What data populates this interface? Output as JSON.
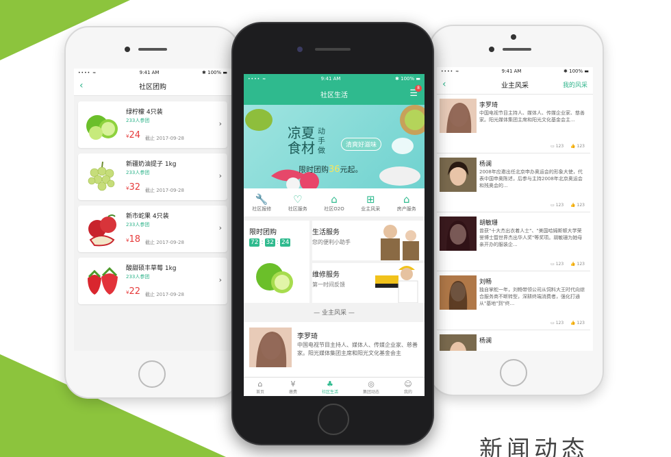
{
  "colors": {
    "accent": "#2fba8e",
    "brand_green": "#8cc43d",
    "price_red": "#e63a3a"
  },
  "news_title": "新闻动态",
  "left_phone": {
    "status": {
      "time": "9:41 AM",
      "battery": "100%"
    },
    "nav_title": "社区团购",
    "products": [
      {
        "name": "绿柠檬 4只装",
        "joined": "233人参团",
        "price": "24",
        "currency": "¥",
        "deadline": "截止 2017-09-28"
      },
      {
        "name": "新疆奶油提子 1kg",
        "joined": "233人参团",
        "price": "32",
        "currency": "¥",
        "deadline": "截止 2017-09-28"
      },
      {
        "name": "新市蛇果 4只装",
        "joined": "233人参团",
        "price": "18",
        "currency": "¥",
        "deadline": "截止 2017-09-28"
      },
      {
        "name": "酸甜硕丰草莓 1kg",
        "joined": "233人参团",
        "price": "22",
        "currency": "¥",
        "deadline": "截止 2017-09-28"
      }
    ]
  },
  "center_phone": {
    "status": {
      "time": "9:41 AM",
      "battery": "100%"
    },
    "nav_title": "社区生活",
    "message_badge": "8",
    "banner": {
      "title_a": "凉夏",
      "title_b": "食材",
      "title_side": "动手做",
      "pill": "清爽好滋味",
      "promo_prefix": "限时团购",
      "promo_number": "36",
      "promo_suffix": "元起。"
    },
    "services": [
      {
        "label": "社区报修",
        "icon": "wrench-icon"
      },
      {
        "label": "社区服务",
        "icon": "heart-icon"
      },
      {
        "label": "社区O2O",
        "icon": "tag-icon"
      },
      {
        "label": "业主风采",
        "icon": "grid-icon"
      },
      {
        "label": "房产服务",
        "icon": "store-icon"
      }
    ],
    "flash_sale": {
      "title": "限时团购",
      "h": "72",
      "m": "32",
      "s": "24"
    },
    "life_service": {
      "title": "生活服务",
      "subtitle": "您的便利小助手"
    },
    "repair_service": {
      "title": "维修服务",
      "subtitle": "第一时间反馈"
    },
    "owners_section": "— 业主风采 —",
    "owner_preview": {
      "name": "李罗琦",
      "desc": "中国电视节目主持人、媒体人、传媒企业家、慈善家。阳光媒体集团主席和阳光文化基金会主"
    },
    "tabs": [
      {
        "label": "首页",
        "icon": "home-icon",
        "active": false
      },
      {
        "label": "缴费",
        "icon": "money-bag-icon",
        "active": false
      },
      {
        "label": "社区生活",
        "icon": "clover-icon",
        "active": true
      },
      {
        "label": "集团动态",
        "icon": "location-icon",
        "active": false
      },
      {
        "label": "我的",
        "icon": "user-icon",
        "active": false
      }
    ]
  },
  "right_phone": {
    "status": {
      "time": "9:41 AM",
      "battery": "100%"
    },
    "nav_title": "业主风采",
    "nav_right": "我的风采",
    "people": [
      {
        "name": "李罗琦",
        "desc": "中国电视节目主持人、媒体人、传媒企业家、慈善家。阳光媒体集团主席和阳光文化基金会主...",
        "comments": "123",
        "likes": "123"
      },
      {
        "name": "杨澜",
        "desc": "2008年应邀出任北京申办奥运会的形象大使，代表中国申奥陈述，后参与主持2008年北京奥运会和残奥会的...",
        "comments": "123",
        "likes": "123"
      },
      {
        "name": "胡敏珊",
        "desc": "曾获\"十大杰出衣着人士\"、\"美国哈姆斯顿大学荣誉博士暨世界杰出华人奖\"等奖项。胡敏珊为她母亲开办的服装企...",
        "comments": "123",
        "likes": "123"
      },
      {
        "name": "刘畅",
        "desc": "独自掌舵一年，刘畅带领公司从饲料大王时代向综合服务商不断转型，深耕终端消费者，强化打通从\"基地\"到\"终...",
        "comments": "123",
        "likes": "123"
      },
      {
        "name": "杨澜",
        "desc": "",
        "comments": "",
        "likes": ""
      }
    ]
  }
}
